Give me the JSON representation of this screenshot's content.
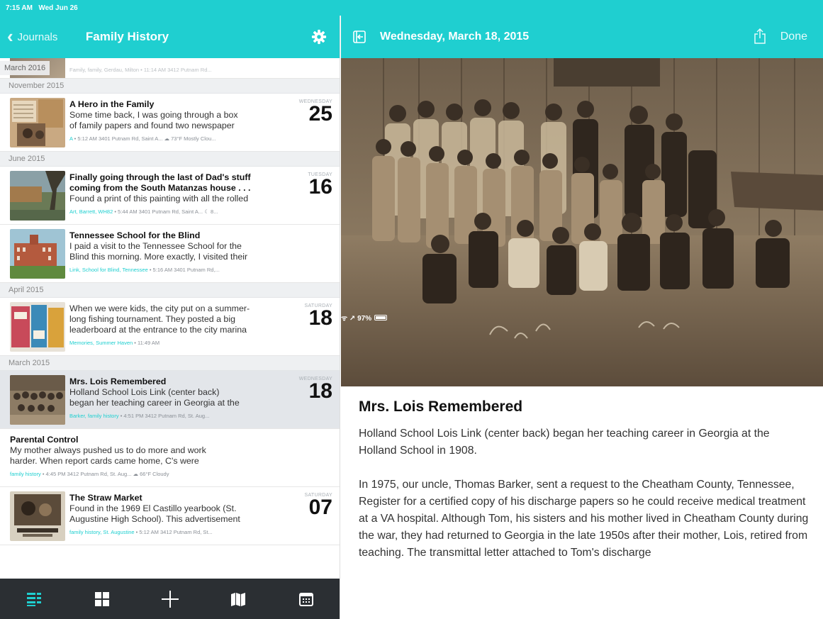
{
  "status_bar": {
    "time": "7:15 AM",
    "date": "Wed Jun 26",
    "signal": "ᯤ ↗ 97%"
  },
  "left_nav": {
    "back_label": "Journals",
    "title": "Family History"
  },
  "list": {
    "partial_top": {
      "section": "March 2016",
      "meta": "Family, family, Gerdau, Milton • 11:14 AM 3412 Putnam Rd..."
    },
    "groups": [
      {
        "section": "November 2015",
        "entries": [
          {
            "title": "A Hero in the Family",
            "body1": "Some time back, I was going through a box",
            "body2": "of family papers and found two newspaper",
            "tags": "A",
            "meta": " • 5:12 AM 3401 Putnam Rd, Saint A... ☁ 73°F Mostly Clou...",
            "dow": "WEDNESDAY",
            "day": "25"
          }
        ]
      },
      {
        "section": "June 2015",
        "entries": [
          {
            "title": "Finally going through the last of Dad's stuff",
            "title2": "coming from the South Matanzas house . . .",
            "body1": "Found a print of this painting with all the rolled",
            "tags": "Art, Barrett, WH82",
            "meta": " • 5:44 AM 3401 Putnam Rd, Saint A... ☾ 8...",
            "dow": "TUESDAY",
            "day": "16"
          },
          {
            "title": "Tennessee School for the Blind",
            "body1": "I paid a visit to the Tennessee School for the",
            "body2": "Blind this morning. More exactly, I visited their",
            "tags": "Link, School for Blind, Tennessee",
            "meta": " • 5:16 AM 3401 Putnam Rd,...",
            "dow": "",
            "day": ""
          }
        ]
      },
      {
        "section": "April 2015",
        "entries": [
          {
            "title": "",
            "body1": "When we were kids, the city put on a summer-",
            "body2": "long fishing tournament. They posted a big",
            "body3": "leaderboard at the entrance to the city marina",
            "tags": "Memories, Summer Haven",
            "meta": " • 11:49 AM",
            "dow": "SATURDAY",
            "day": "18"
          }
        ]
      },
      {
        "section": "March 2015",
        "entries": [
          {
            "title": "Mrs. Lois Remembered",
            "body1": "Holland School Lois Link (center back)",
            "body2": "began her teaching career in Georgia at the",
            "tags": "Barker, family history",
            "meta": " • 4:51 PM 3412 Putnam Rd, St. Aug...",
            "dow": "WEDNESDAY",
            "day": "18"
          },
          {
            "title": "Parental Control",
            "body1": "My mother always pushed us to do more and work",
            "body2": "harder. When report cards came home, C's were",
            "tags": "family history",
            "meta": " • 4:45 PM 3412 Putnam Rd, St. Aug... ☁ 66°F Cloudy",
            "dow": "",
            "day": ""
          },
          {
            "title": "The Straw Market",
            "body1": "Found in the 1969 El Castillo yearbook (St.",
            "body2": "Augustine High School). This advertisement",
            "tags": "family history, St. Augustine",
            "meta": " • 5:12 AM 3412 Putnam Rd, St...",
            "dow": "SATURDAY",
            "day": "07"
          }
        ]
      }
    ]
  },
  "toolbar": {
    "items": [
      "list-view",
      "grid-view",
      "add",
      "map-view",
      "calendar-view"
    ]
  },
  "right_nav": {
    "date": "Wednesday, March 18, 2015",
    "done_label": "Done"
  },
  "article": {
    "title": "Mrs. Lois Remembered",
    "p1": "Holland School Lois Link (center back) began her teaching career in Georgia at the Holland School in 1908.",
    "p2": "In 1975, our uncle, Thomas Barker, sent a request to the Cheatham County, Tennessee, Register for a certified copy of his discharge papers so he could receive medical treatment at a VA hospital. Although Tom, his sisters and his mother lived in Cheatham County during the war, they had returned to Georgia in the late 1950s after their mother, Lois, retired from teaching. The transmittal letter attached to Tom's discharge"
  },
  "colors": {
    "accent": "#1fcfd0",
    "toolbar": "#2b2f33",
    "selected_row": "#e3e6ea",
    "section_bg": "#eef0f2"
  }
}
